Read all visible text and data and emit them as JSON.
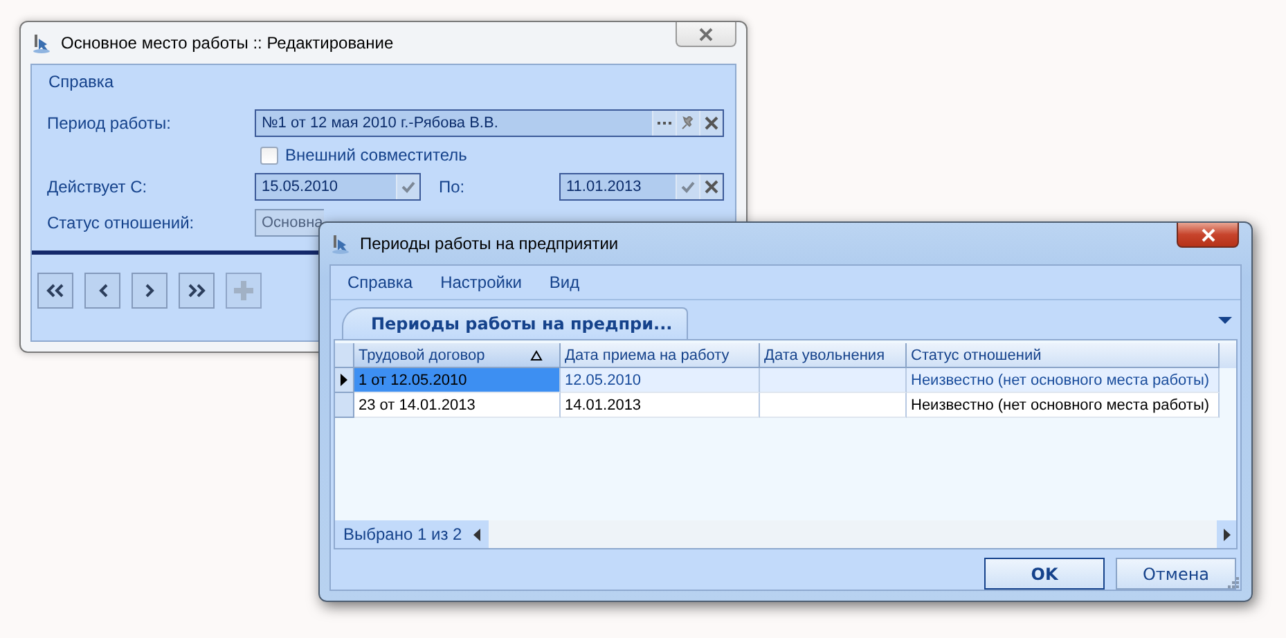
{
  "edit_window": {
    "title": "Основное место работы :: Редактирование",
    "menu": [
      "Справка"
    ],
    "period": {
      "label": "Период работы:",
      "value": "№1 от  12 мая 2010 г.-Рябова В.В."
    },
    "external": {
      "label": "Внешний совместитель",
      "checked": false
    },
    "from": {
      "label": "Действует С:",
      "value": "15.05.2010"
    },
    "to": {
      "label": "По:",
      "value": "11.01.2013"
    },
    "status": {
      "label": "Статус отношений:",
      "value": "Основна"
    },
    "nav_buttons": [
      {
        "kind": "first",
        "disabled": false
      },
      {
        "kind": "prev",
        "disabled": false
      },
      {
        "kind": "next",
        "disabled": false
      },
      {
        "kind": "last",
        "disabled": false
      },
      {
        "kind": "add",
        "disabled": true
      }
    ]
  },
  "list_window": {
    "title": "Периоды работы на предприятии",
    "menu": [
      "Справка",
      "Настройки",
      "Вид"
    ],
    "tab": {
      "label": "Периоды работы на предпри...",
      "selected": true
    },
    "table": {
      "columns": [
        {
          "label": "Трудовой договор",
          "sorted": true
        },
        {
          "label": "Дата приема на работу",
          "sorted": false
        },
        {
          "label": "Дата увольнения",
          "sorted": false
        },
        {
          "label": "Статус отношений",
          "sorted": false
        }
      ],
      "rows": [
        {
          "cells": [
            "1 от 12.05.2010",
            "12.05.2010",
            "",
            "Неизвестно (нет основного места работы)"
          ],
          "selected": true
        },
        {
          "cells": [
            "23 от 14.01.2013",
            "14.01.2013",
            "",
            "Неизвестно (нет основного места работы)"
          ],
          "selected": false
        }
      ]
    },
    "status": "Выбрано 1 из 2",
    "buttons": [
      {
        "label": "OK",
        "default": true
      },
      {
        "label": "Отмена",
        "default": false
      }
    ]
  }
}
